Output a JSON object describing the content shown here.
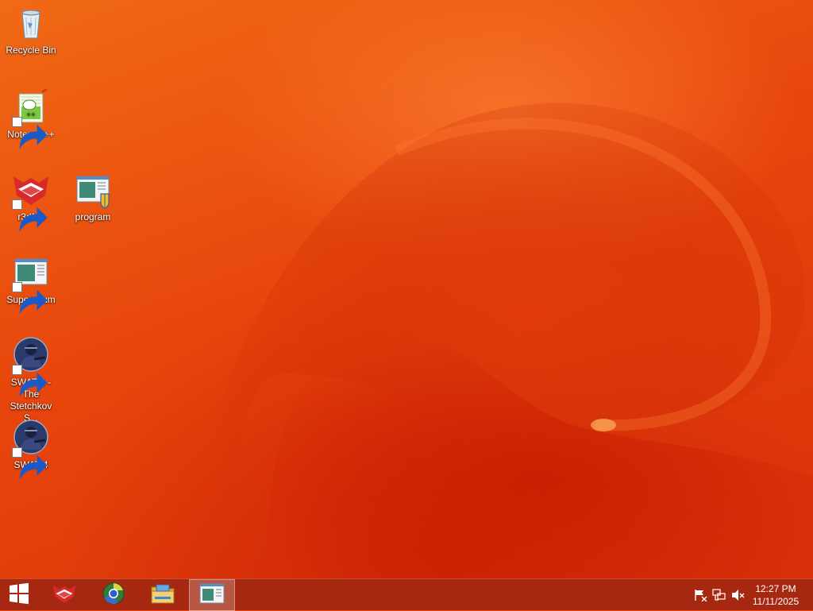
{
  "desktop": {
    "icons": [
      {
        "label": "Recycle Bin",
        "icon": "recycle-bin-icon"
      },
      {
        "label": "Notepad++",
        "icon": "notepad-plus-plus-icon"
      },
      {
        "label": "r3dfox",
        "icon": "r3dfox-icon"
      },
      {
        "label": "program",
        "icon": "program-icon"
      },
      {
        "label": "Supermium",
        "icon": "supermium-icon"
      },
      {
        "label": "SWAT 4 - The Stetchkov S...",
        "icon": "swat4-stetchkov-icon"
      },
      {
        "label": "SWAT 4",
        "icon": "swat4-icon"
      }
    ]
  },
  "taskbar": {
    "start": {
      "icon": "windows-logo-icon"
    },
    "pinned": [
      {
        "icon": "r3dfox-icon",
        "active": false
      },
      {
        "icon": "supermium-icon",
        "active": false
      },
      {
        "icon": "file-explorer-icon",
        "active": false
      },
      {
        "icon": "program-window-icon",
        "active": true
      }
    ],
    "tray": [
      {
        "icon": "action-center-flag-icon"
      },
      {
        "icon": "network-icon"
      },
      {
        "icon": "volume-muted-icon"
      }
    ],
    "clock": {
      "time": "12:27 PM",
      "date": "11/11/2025"
    }
  },
  "colors": {
    "wallpaper": "#e8430a",
    "taskbar": "#a02612"
  }
}
